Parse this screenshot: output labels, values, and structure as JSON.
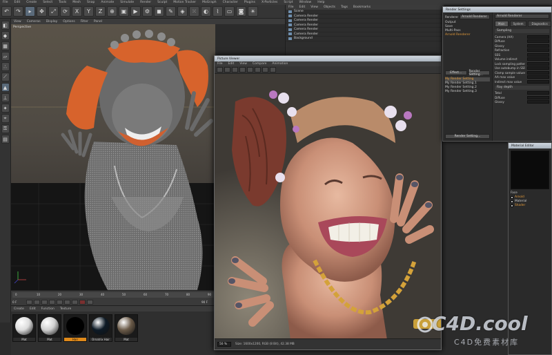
{
  "app": {
    "main_menu": [
      "File",
      "Edit",
      "Create",
      "Select",
      "Tools",
      "Mesh",
      "Snap",
      "Animate",
      "Simulate",
      "Render",
      "Sculpt",
      "Motion Tracker",
      "MoGraph",
      "Character",
      "Plugins",
      "X-Particles",
      "Script",
      "Window",
      "Help"
    ],
    "toolbar_icons": [
      "undo-icon",
      "redo-icon",
      "select-icon",
      "move-icon",
      "scale-icon",
      "rotate-icon",
      "x-axis-icon",
      "y-axis-icon",
      "z-axis-icon",
      "coord-icon",
      "render-region-icon",
      "render-view-icon",
      "render-settings-icon",
      "cube-icon",
      "pen-icon",
      "subdivision-icon",
      "array-icon",
      "boole-icon",
      "deformer-icon",
      "floor-icon",
      "camera-icon",
      "light-icon"
    ]
  },
  "viewport": {
    "menu": [
      "View",
      "Cameras",
      "Display",
      "Options",
      "Filter",
      "Panel"
    ],
    "label": "Perspective",
    "axis_labels": [
      "Y",
      "X",
      "Z"
    ]
  },
  "timeline": {
    "ticks": [
      "0",
      "10",
      "20",
      "30",
      "40",
      "50",
      "60",
      "70",
      "80",
      "90"
    ],
    "frame_start": "0 F",
    "frame_end": "90 F",
    "current": "0 F"
  },
  "material_manager": {
    "menu": [
      "Create",
      "Edit",
      "Function",
      "Texture"
    ],
    "materials": [
      {
        "label": "Mat",
        "color": "#dcdcdc",
        "selected": false
      },
      {
        "label": "Mat",
        "color": "#d0d0d0",
        "selected": false
      },
      {
        "label": "Hair",
        "color": "#000000",
        "selected": true
      },
      {
        "label": "Ornatrix Hair",
        "color": "#0d1a26",
        "selected": false
      },
      {
        "label": "Mat",
        "color": "#6a5a48",
        "selected": false
      }
    ]
  },
  "object_manager": {
    "menu": [
      "File",
      "Edit",
      "View",
      "Objects",
      "Tags",
      "Bookmarks"
    ],
    "objects": [
      "Scene",
      "Camera Render",
      "Camera Render",
      "Camera Render",
      "Camera Render",
      "Camera Render",
      "Background"
    ]
  },
  "render_settings": {
    "title": "Render Settings",
    "renderer_label": "Renderer",
    "renderer_value": "Arnold Renderer",
    "left_items": [
      {
        "label": "Output",
        "style": "normal"
      },
      {
        "label": "Save",
        "style": "normal"
      },
      {
        "label": "Multi-Pass",
        "style": "normal"
      },
      {
        "label": "Arnold Renderer",
        "style": "orange"
      }
    ],
    "buttons": [
      "Effect...",
      "Render Setting..."
    ],
    "settings": [
      {
        "label": "My Render Setting",
        "style": "orange"
      },
      {
        "label": "My Render Setting.1",
        "style": "normal"
      },
      {
        "label": "My Render Setting.2",
        "style": "normal"
      },
      {
        "label": "My Render Setting.3",
        "style": "normal"
      }
    ],
    "bottom_button": "Render Setting...",
    "tabs": [
      "Main",
      "System",
      "Diagnostics",
      "Override"
    ],
    "section_sampling": "Sampling",
    "params": [
      "Camera (AA)",
      "Diffuse",
      "Glossy",
      "Refraction",
      "SSS",
      "Volume indirect",
      "Lock sampling pattern",
      "Use autobump in SSS",
      "Clamp sample values",
      "AA max value",
      "Indirect max value"
    ],
    "section_ray_depth": "Ray depth",
    "params2": [
      "Total",
      "Diffuse",
      "Glossy"
    ]
  },
  "picture_viewer": {
    "title": "Picture Viewer",
    "menu": [
      "File",
      "Edit",
      "View",
      "Compare",
      "Animation"
    ],
    "zoom": "50 %",
    "status": "Size: 1600x1200, RGB (8 Bit), 42.38 MB"
  },
  "material_editor": {
    "title": "Material Editor",
    "label": "Face",
    "items": [
      {
        "label": "Arnold",
        "style": "orange"
      },
      {
        "label": "Material",
        "style": "normal"
      },
      {
        "label": "Shader",
        "style": "orange"
      }
    ]
  },
  "watermark": {
    "brand": "C4D.cool",
    "subtitle": "C4D免费素材库"
  }
}
